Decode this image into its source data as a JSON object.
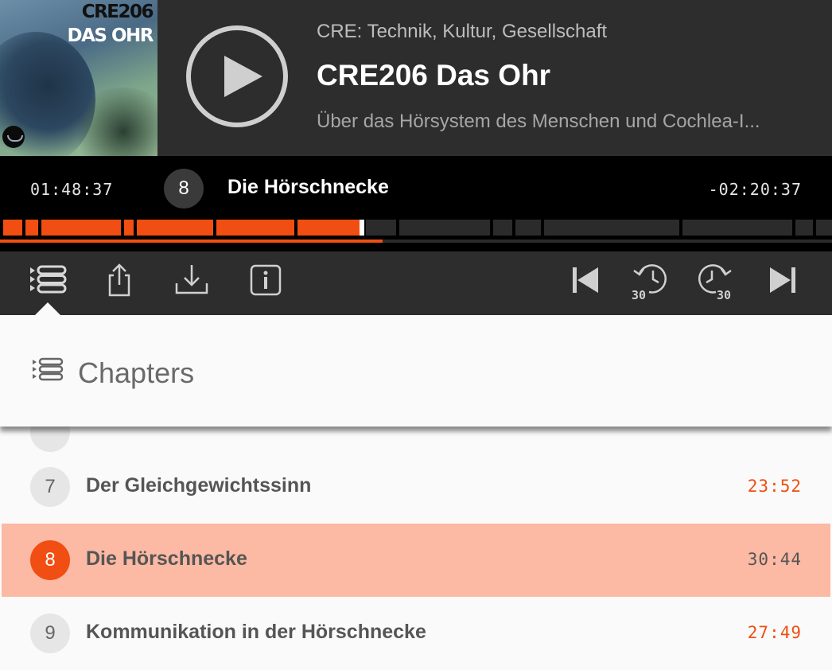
{
  "cover": {
    "title": "CRE206",
    "subtitle": "DAS OHR"
  },
  "header": {
    "show_name": "CRE: Technik, Kultur, Gesellschaft",
    "episode_title": "CRE206 Das Ohr",
    "episode_description": "Über das Hörsystem des Menschen und Cochlea-I..."
  },
  "now_playing": {
    "elapsed": "01:48:37",
    "remaining": "-02:20:37",
    "chapter_number": "8",
    "chapter_title": "Die Hörschnecke",
    "overall_progress": 0.46
  },
  "toolbar": {
    "left_icons": [
      "chapters-icon",
      "share-icon",
      "download-icon",
      "info-icon"
    ],
    "right_icons": [
      "skip-previous-icon",
      "rewind-30-icon",
      "forward-30-icon",
      "skip-next-icon"
    ],
    "skip_seconds": "30"
  },
  "chapters_panel": {
    "title": "Chapters",
    "items": [
      {
        "number": "7",
        "title": "Der Gleichgewichtssinn",
        "duration": "23:52",
        "active": false
      },
      {
        "number": "8",
        "title": "Die Hörschnecke",
        "duration": "30:44",
        "active": true
      },
      {
        "number": "9",
        "title": "Kommunikation in der Hörschnecke",
        "duration": "27:49",
        "active": false
      }
    ]
  },
  "colors": {
    "accent": "#f04e12",
    "active_row": "#fcb9a3",
    "header_bg": "#2d2d2d",
    "bar_bg": "#000000"
  }
}
